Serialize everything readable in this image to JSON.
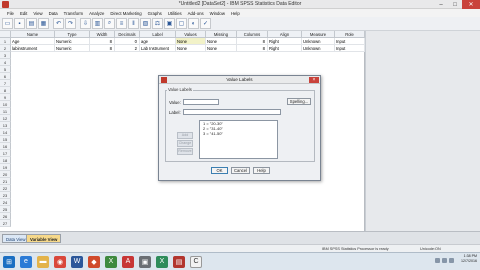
{
  "window": {
    "title": "*Untitled2 [DataSet2] - IBM SPSS Statistics Data Editor",
    "min": "–",
    "max": "□",
    "close": "✕"
  },
  "menu": [
    "File",
    "Edit",
    "View",
    "Data",
    "Transform",
    "Analyze",
    "Direct Marketing",
    "Graphs",
    "Utilities",
    "Add-ons",
    "Window",
    "Help"
  ],
  "grid": {
    "columns": [
      "Name",
      "Type",
      "Width",
      "Decimals",
      "Label",
      "Values",
      "Missing",
      "Columns",
      "Align",
      "Measure",
      "Role"
    ],
    "rows": [
      {
        "num": "1",
        "name": "Age",
        "type": "Numeric",
        "width": "8",
        "decimals": "0",
        "label": "age",
        "values": "None",
        "missing": "None",
        "columns": "8",
        "align": "Right",
        "measure": "Unknown",
        "role": "Input"
      },
      {
        "num": "2",
        "name": "labinstrument",
        "type": "Numeric",
        "width": "8",
        "decimals": "2",
        "label": "Lab Instrument",
        "values": "None",
        "missing": "None",
        "columns": "8",
        "align": "Right",
        "measure": "Unknown",
        "role": "Input"
      }
    ],
    "row_numbers": [
      "1",
      "2",
      "3",
      "4",
      "5",
      "6",
      "7",
      "8",
      "9",
      "10",
      "11",
      "12",
      "13",
      "14",
      "15",
      "16",
      "17",
      "18",
      "19",
      "20",
      "21",
      "22",
      "23",
      "24",
      "25",
      "26",
      "27"
    ]
  },
  "tabs": {
    "data_view": "Data View",
    "variable_view": "Variable View"
  },
  "status": {
    "processor": "IBM SPSS Statistics Processor is ready",
    "unicode": "Unicode:ON"
  },
  "tray": {
    "time": "1:38 PM",
    "date": "12/7/2016"
  },
  "dialog": {
    "title": "Value Labels",
    "group": "Value Labels",
    "value_label": "Value:",
    "label_label": "Label:",
    "value_input": "",
    "label_input": "",
    "spelling": "Spelling...",
    "add": "Add",
    "change": "Change",
    "remove": "Remove",
    "list": [
      "1 = \"20-30\"",
      "2 = \"31-40\"",
      "3 = \"41-50\""
    ],
    "ok": "OK",
    "cancel": "Cancel",
    "help": "Help"
  },
  "colors": {
    "accent": "#2b5797",
    "close": "#c9423b",
    "selected_cell": "#f2f2c8",
    "var_tab": "#f6d88a"
  },
  "taskbar_icons": [
    "start-icon",
    "ie-icon",
    "folder-icon",
    "chrome-icon",
    "word-icon",
    "excel-icon",
    "spss-icon",
    "app-icon",
    "app2-icon",
    "app3-icon",
    "excel2-icon",
    "app4-icon"
  ]
}
